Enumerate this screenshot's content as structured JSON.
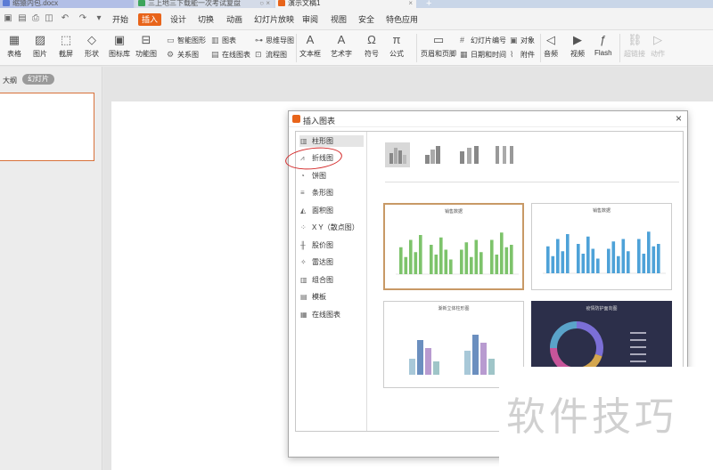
{
  "tabs": [
    {
      "label": "缩猿内包.docx"
    },
    {
      "label": "三上地三下载能一次考试复盘"
    },
    {
      "label": "演示文稿1"
    }
  ],
  "tab_add": "+",
  "menu": [
    "开始",
    "插入",
    "设计",
    "切换",
    "动画",
    "幻灯片放映",
    "审阅",
    "视图",
    "安全",
    "特色应用"
  ],
  "menu_active": "插入",
  "ribbon": {
    "table": "表格",
    "picture": "图片",
    "screenshot": "截屏",
    "shape": "形状",
    "icon_lib": "图标库",
    "func_chart": "功能图",
    "smart_shape": "智能图形",
    "chart": "图表",
    "mindmap": "思维导图",
    "relation": "关系图",
    "online_chart": "在线图表",
    "flowchart": "流程图",
    "textbox": "文本框",
    "art_text": "艺术字",
    "symbol": "符号",
    "formula": "公式",
    "header_footer": "页眉和页脚",
    "slide_number": "幻灯片编号",
    "object": "对象",
    "datetime": "日期和时间",
    "attachment": "附件",
    "audio": "音频",
    "video": "视频",
    "flash": "Flash",
    "hyperlink": "超链接",
    "action": "动作"
  },
  "left_panel": {
    "outline": "大纲",
    "slides": "幻灯片"
  },
  "dialog": {
    "title": "插入图表",
    "close": "×",
    "categories": [
      "柱形图",
      "折线图",
      "饼图",
      "条形图",
      "面积图",
      "X Y（散点图）",
      "股价图",
      "雷达图",
      "组合图",
      "模板",
      "在线图表"
    ],
    "selected_category": "柱形图",
    "previews": [
      {
        "title": "销售数据"
      },
      {
        "title": "销售数据"
      },
      {
        "title": "渐新立体柱形图"
      },
      {
        "title": "疫情防护面向图"
      }
    ]
  },
  "watermark": "软件技巧",
  "colors": {
    "accent": "#e8641a",
    "green": "#7dc36b",
    "blue": "#4ea2d8",
    "annotation": "#d42a2a"
  }
}
